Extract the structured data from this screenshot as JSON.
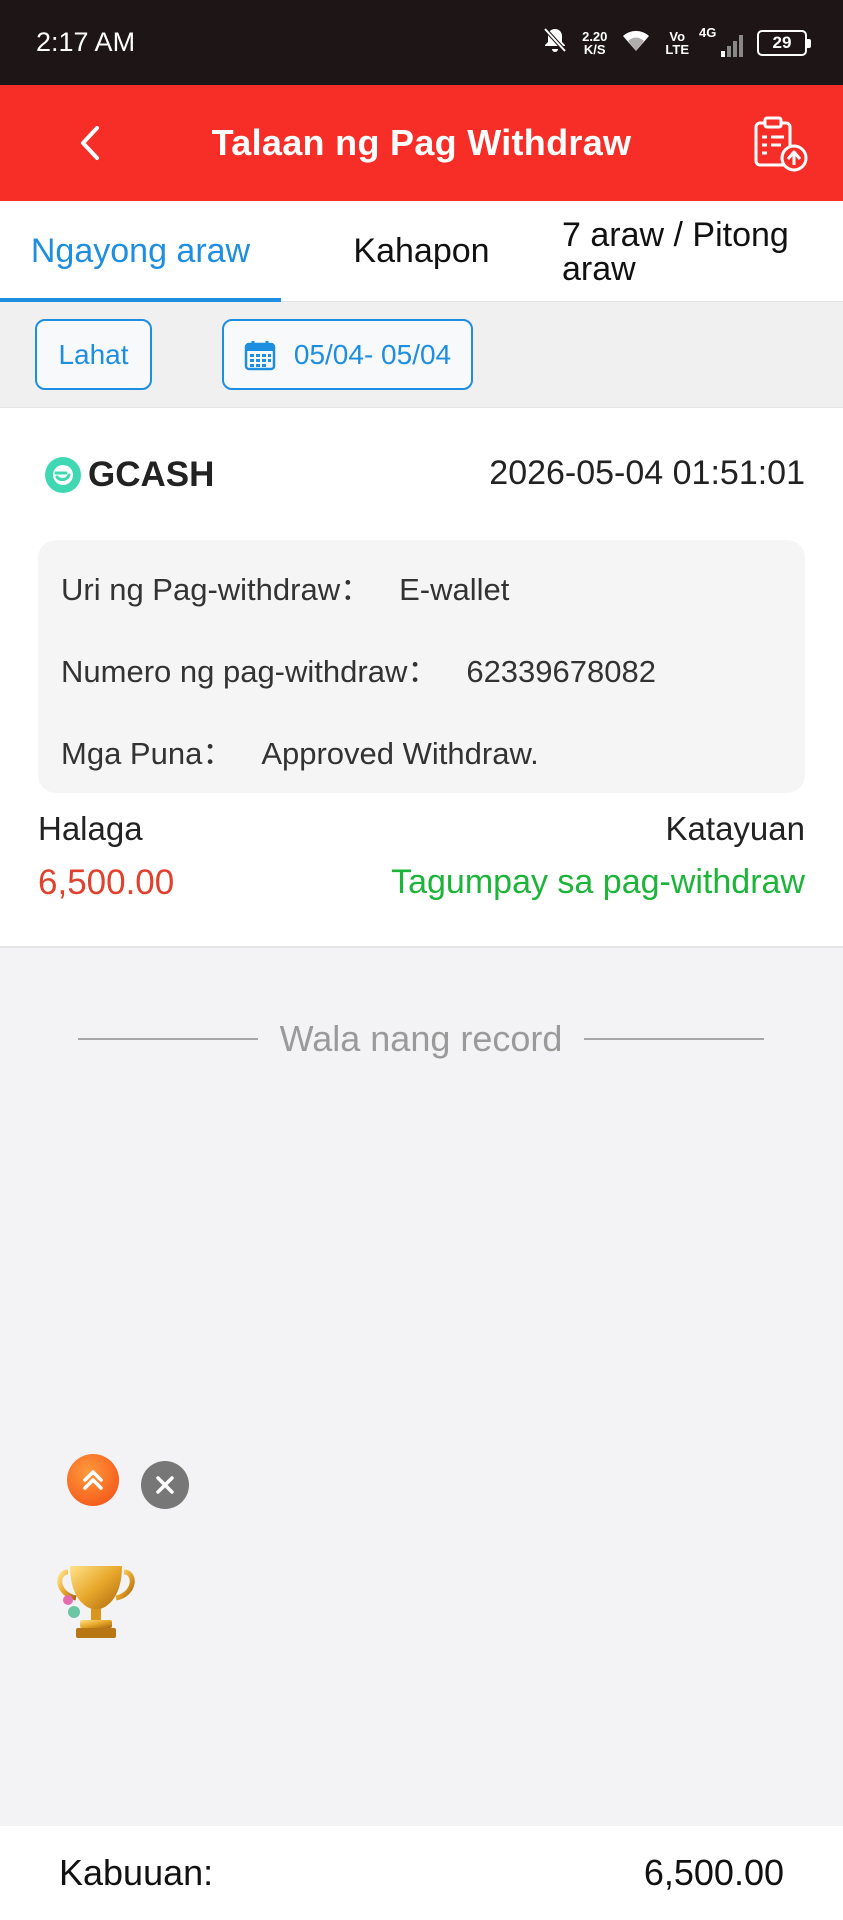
{
  "status_bar": {
    "time": "2:17 AM",
    "net_speed_value": "2.20",
    "net_speed_unit": "K/S",
    "volte_top": "Vo",
    "volte_bottom": "LTE",
    "network": "4G",
    "battery": "29",
    "icons": [
      "bell-muted-icon",
      "wifi-icon",
      "signal-icon",
      "battery-icon"
    ]
  },
  "header": {
    "title": "Talaan ng Pag Withdraw",
    "back_icon": "chevron-left-icon",
    "action_icon": "clipboard-upload-icon"
  },
  "tabs": [
    {
      "label": "Ngayong araw",
      "active": true
    },
    {
      "label": "Kahapon",
      "active": false
    },
    {
      "label": "7 araw / Pitong araw",
      "active": false
    }
  ],
  "filters": {
    "type_label": "Lahat",
    "date_range": "05/04- 05/04",
    "date_icon": "calendar-icon"
  },
  "record": {
    "provider_name": "GCASH",
    "provider_icon": "gcash-logo-icon",
    "datetime": "2026-05-04 01:51:01",
    "withdraw_type_label": "Uri ng Pag-withdraw：",
    "withdraw_type_value": "E-wallet",
    "withdraw_number_label": "Numero ng pag-withdraw：",
    "withdraw_number_value": "62339678082",
    "remarks_label": "Mga Puna：",
    "remarks_value": "Approved Withdraw.",
    "amount_label": "Halaga",
    "amount_value": "6,500.00",
    "status_label": "Katayuan",
    "status_value": "Tagumpay sa pag-withdraw"
  },
  "list_end_text": "Wala nang record",
  "floating": {
    "up_icon": "double-chevron-up-icon",
    "close_icon": "close-icon",
    "trophy_icon": "trophy-icon"
  },
  "footer": {
    "label": "Kabuuan:",
    "total": "6,500.00"
  },
  "colors": {
    "header_red": "#f72d27",
    "accent_blue": "#1e8ee0",
    "amount_red": "#e1402d",
    "success_green": "#1cb53a"
  }
}
